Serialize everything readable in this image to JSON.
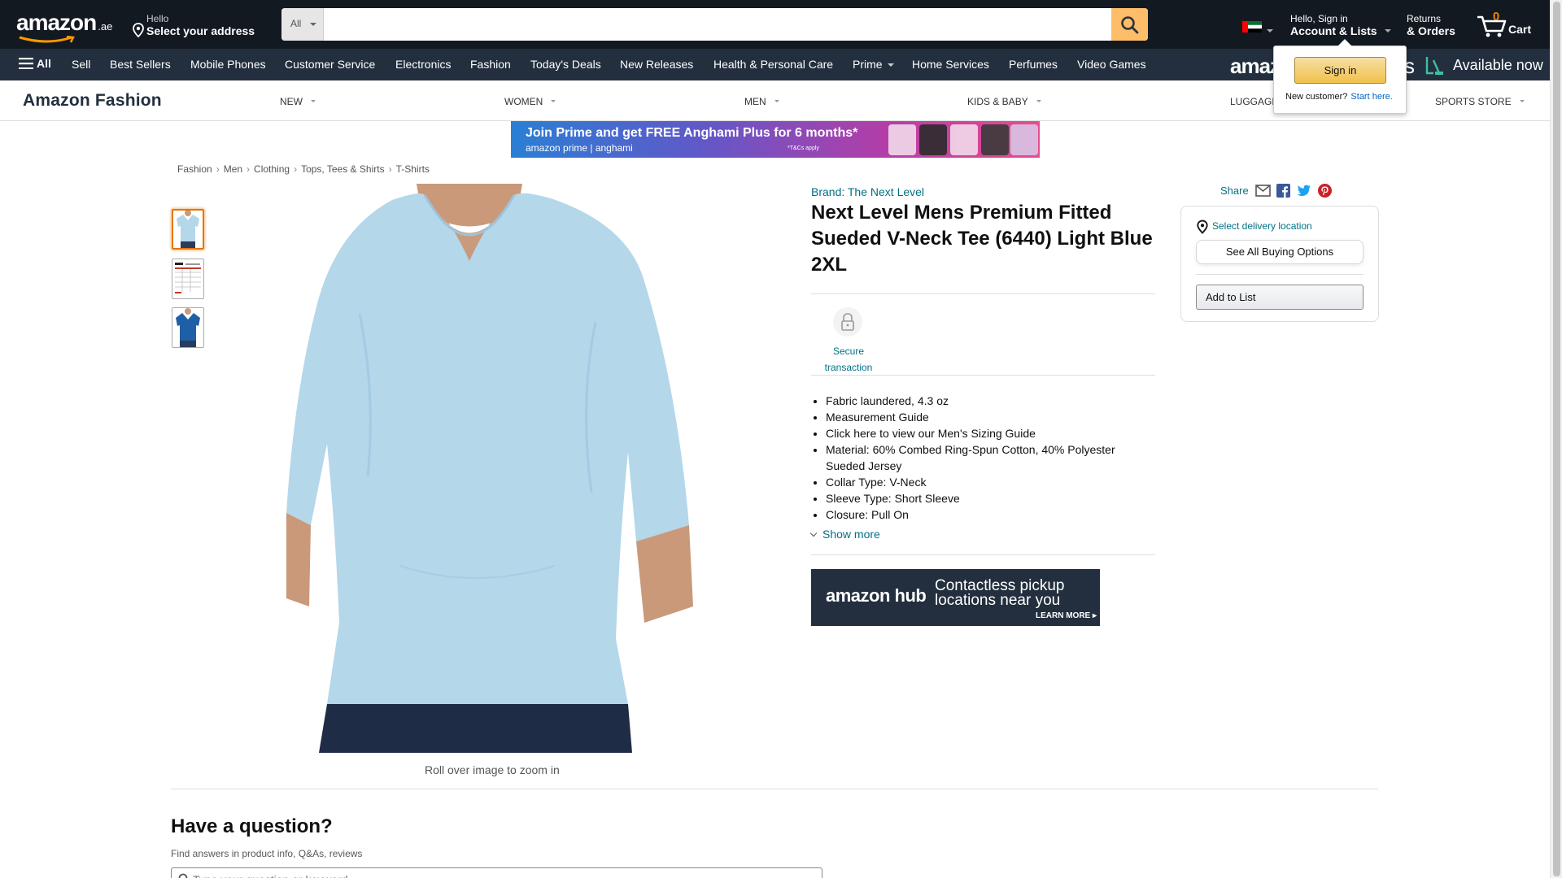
{
  "header": {
    "logo_text": "amazon",
    "logo_tld": ".ae",
    "location": {
      "line1": "Hello",
      "line2": "Select your address"
    },
    "search": {
      "category": "All",
      "placeholder": "",
      "value": ""
    },
    "account": {
      "line1": "Hello, Sign in",
      "line2": "Account & Lists"
    },
    "returns": {
      "line1": "Returns",
      "line2": "& Orders"
    },
    "cart": {
      "count": "0",
      "label": "Cart"
    }
  },
  "nav": {
    "all_label": "All",
    "items": [
      "Sell",
      "Best Sellers",
      "Mobile Phones",
      "Customer Service",
      "Electronics",
      "Fashion",
      "Today's Deals",
      "New Releases",
      "Health & Personal Care",
      "Prime",
      "Home Services",
      "Perfumes",
      "Video Games"
    ],
    "promo": {
      "brand": "amaz",
      "tail": "s",
      "text": "Available now"
    }
  },
  "flyout": {
    "signin_label": "Sign in",
    "new_customer": "New customer?",
    "start_here": "Start here."
  },
  "fashion_nav": {
    "brand": "Amazon Fashion",
    "categories": [
      "NEW",
      "WOMEN",
      "MEN",
      "KIDS & BABY",
      "LUGGAGE",
      "SPORTS STORE"
    ]
  },
  "banner": {
    "headline": "Join Prime and get FREE Anghami Plus for 6 months*",
    "brands": "amazon prime  |  anghami",
    "terms": "*T&Cs apply"
  },
  "breadcrumb": [
    "Fashion",
    "Men",
    "Clothing",
    "Tops, Tees & Shirts",
    "T-Shirts"
  ],
  "gallery": {
    "zoom_hint": "Roll over image to zoom in"
  },
  "product": {
    "brand_link": "Brand: The Next Level",
    "title": "Next Level Mens Premium Fitted Sueded V-Neck Tee (6440) Light Blue 2XL",
    "secure_label": "Secure transaction",
    "bullets": [
      "Fabric laundered, 4.3 oz",
      "Measurement Guide",
      "Click here to view our Men's Sizing Guide",
      "Material: 60% Combed Ring-Spun Cotton, 40% Polyester Sueded Jersey",
      "Collar Type: V-Neck",
      "Sleeve Type: Short Sleeve",
      "Closure: Pull On"
    ],
    "show_more": "Show more",
    "hub_ad": {
      "brand": "amazon hub",
      "line1": "Contactless pickup",
      "line2": "locations near you",
      "cta": "LEARN MORE ▸"
    }
  },
  "share": {
    "label": "Share"
  },
  "buybox": {
    "delivery_location": "Select delivery location",
    "buying_options": "See All Buying Options",
    "add_to_list": "Add to List"
  },
  "qa": {
    "heading": "Have a question?",
    "subtext": "Find answers in product info, Q&As, reviews",
    "placeholder": "Type your question or keyword"
  },
  "colors": {
    "nav_dark": "#131921",
    "nav_main": "#232f3e",
    "search_button": "#febd69",
    "link": "#007185",
    "cart_count": "#f08804",
    "shirt": "#b4d7ea"
  }
}
